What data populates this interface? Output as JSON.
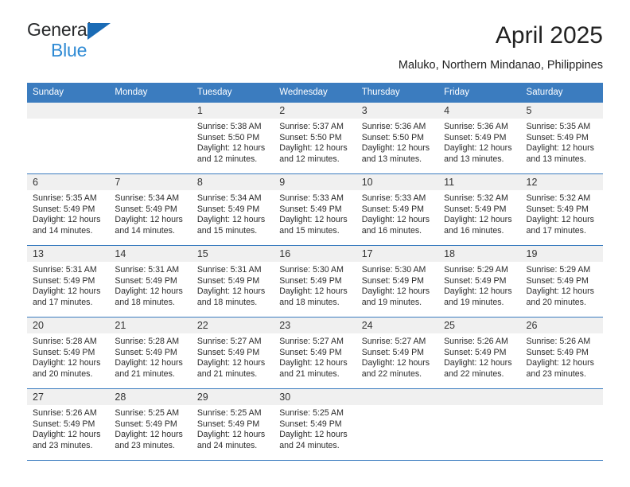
{
  "brand": {
    "name_line1": "General",
    "name_line2": "Blue",
    "color_dark": "#27292b",
    "color_blue": "#2e8ad4",
    "triangle_color": "#1a6bb5"
  },
  "header": {
    "title": "April 2025",
    "subtitle": "Maluko, Northern Mindanao, Philippines"
  },
  "theme": {
    "header_blue": "#3b7cbf",
    "daynum_gray": "#f0f0f0",
    "text": "#222222"
  },
  "calendar": {
    "weekday_headers": [
      "Sunday",
      "Monday",
      "Tuesday",
      "Wednesday",
      "Thursday",
      "Friday",
      "Saturday"
    ],
    "weeks": [
      [
        {
          "day": "",
          "sunrise": "",
          "sunset": "",
          "daylight_l1": "",
          "daylight_l2": ""
        },
        {
          "day": "",
          "sunrise": "",
          "sunset": "",
          "daylight_l1": "",
          "daylight_l2": ""
        },
        {
          "day": "1",
          "sunrise": "Sunrise: 5:38 AM",
          "sunset": "Sunset: 5:50 PM",
          "daylight_l1": "Daylight: 12 hours",
          "daylight_l2": "and 12 minutes."
        },
        {
          "day": "2",
          "sunrise": "Sunrise: 5:37 AM",
          "sunset": "Sunset: 5:50 PM",
          "daylight_l1": "Daylight: 12 hours",
          "daylight_l2": "and 12 minutes."
        },
        {
          "day": "3",
          "sunrise": "Sunrise: 5:36 AM",
          "sunset": "Sunset: 5:50 PM",
          "daylight_l1": "Daylight: 12 hours",
          "daylight_l2": "and 13 minutes."
        },
        {
          "day": "4",
          "sunrise": "Sunrise: 5:36 AM",
          "sunset": "Sunset: 5:49 PM",
          "daylight_l1": "Daylight: 12 hours",
          "daylight_l2": "and 13 minutes."
        },
        {
          "day": "5",
          "sunrise": "Sunrise: 5:35 AM",
          "sunset": "Sunset: 5:49 PM",
          "daylight_l1": "Daylight: 12 hours",
          "daylight_l2": "and 13 minutes."
        }
      ],
      [
        {
          "day": "6",
          "sunrise": "Sunrise: 5:35 AM",
          "sunset": "Sunset: 5:49 PM",
          "daylight_l1": "Daylight: 12 hours",
          "daylight_l2": "and 14 minutes."
        },
        {
          "day": "7",
          "sunrise": "Sunrise: 5:34 AM",
          "sunset": "Sunset: 5:49 PM",
          "daylight_l1": "Daylight: 12 hours",
          "daylight_l2": "and 14 minutes."
        },
        {
          "day": "8",
          "sunrise": "Sunrise: 5:34 AM",
          "sunset": "Sunset: 5:49 PM",
          "daylight_l1": "Daylight: 12 hours",
          "daylight_l2": "and 15 minutes."
        },
        {
          "day": "9",
          "sunrise": "Sunrise: 5:33 AM",
          "sunset": "Sunset: 5:49 PM",
          "daylight_l1": "Daylight: 12 hours",
          "daylight_l2": "and 15 minutes."
        },
        {
          "day": "10",
          "sunrise": "Sunrise: 5:33 AM",
          "sunset": "Sunset: 5:49 PM",
          "daylight_l1": "Daylight: 12 hours",
          "daylight_l2": "and 16 minutes."
        },
        {
          "day": "11",
          "sunrise": "Sunrise: 5:32 AM",
          "sunset": "Sunset: 5:49 PM",
          "daylight_l1": "Daylight: 12 hours",
          "daylight_l2": "and 16 minutes."
        },
        {
          "day": "12",
          "sunrise": "Sunrise: 5:32 AM",
          "sunset": "Sunset: 5:49 PM",
          "daylight_l1": "Daylight: 12 hours",
          "daylight_l2": "and 17 minutes."
        }
      ],
      [
        {
          "day": "13",
          "sunrise": "Sunrise: 5:31 AM",
          "sunset": "Sunset: 5:49 PM",
          "daylight_l1": "Daylight: 12 hours",
          "daylight_l2": "and 17 minutes."
        },
        {
          "day": "14",
          "sunrise": "Sunrise: 5:31 AM",
          "sunset": "Sunset: 5:49 PM",
          "daylight_l1": "Daylight: 12 hours",
          "daylight_l2": "and 18 minutes."
        },
        {
          "day": "15",
          "sunrise": "Sunrise: 5:31 AM",
          "sunset": "Sunset: 5:49 PM",
          "daylight_l1": "Daylight: 12 hours",
          "daylight_l2": "and 18 minutes."
        },
        {
          "day": "16",
          "sunrise": "Sunrise: 5:30 AM",
          "sunset": "Sunset: 5:49 PM",
          "daylight_l1": "Daylight: 12 hours",
          "daylight_l2": "and 18 minutes."
        },
        {
          "day": "17",
          "sunrise": "Sunrise: 5:30 AM",
          "sunset": "Sunset: 5:49 PM",
          "daylight_l1": "Daylight: 12 hours",
          "daylight_l2": "and 19 minutes."
        },
        {
          "day": "18",
          "sunrise": "Sunrise: 5:29 AM",
          "sunset": "Sunset: 5:49 PM",
          "daylight_l1": "Daylight: 12 hours",
          "daylight_l2": "and 19 minutes."
        },
        {
          "day": "19",
          "sunrise": "Sunrise: 5:29 AM",
          "sunset": "Sunset: 5:49 PM",
          "daylight_l1": "Daylight: 12 hours",
          "daylight_l2": "and 20 minutes."
        }
      ],
      [
        {
          "day": "20",
          "sunrise": "Sunrise: 5:28 AM",
          "sunset": "Sunset: 5:49 PM",
          "daylight_l1": "Daylight: 12 hours",
          "daylight_l2": "and 20 minutes."
        },
        {
          "day": "21",
          "sunrise": "Sunrise: 5:28 AM",
          "sunset": "Sunset: 5:49 PM",
          "daylight_l1": "Daylight: 12 hours",
          "daylight_l2": "and 21 minutes."
        },
        {
          "day": "22",
          "sunrise": "Sunrise: 5:27 AM",
          "sunset": "Sunset: 5:49 PM",
          "daylight_l1": "Daylight: 12 hours",
          "daylight_l2": "and 21 minutes."
        },
        {
          "day": "23",
          "sunrise": "Sunrise: 5:27 AM",
          "sunset": "Sunset: 5:49 PM",
          "daylight_l1": "Daylight: 12 hours",
          "daylight_l2": "and 21 minutes."
        },
        {
          "day": "24",
          "sunrise": "Sunrise: 5:27 AM",
          "sunset": "Sunset: 5:49 PM",
          "daylight_l1": "Daylight: 12 hours",
          "daylight_l2": "and 22 minutes."
        },
        {
          "day": "25",
          "sunrise": "Sunrise: 5:26 AM",
          "sunset": "Sunset: 5:49 PM",
          "daylight_l1": "Daylight: 12 hours",
          "daylight_l2": "and 22 minutes."
        },
        {
          "day": "26",
          "sunrise": "Sunrise: 5:26 AM",
          "sunset": "Sunset: 5:49 PM",
          "daylight_l1": "Daylight: 12 hours",
          "daylight_l2": "and 23 minutes."
        }
      ],
      [
        {
          "day": "27",
          "sunrise": "Sunrise: 5:26 AM",
          "sunset": "Sunset: 5:49 PM",
          "daylight_l1": "Daylight: 12 hours",
          "daylight_l2": "and 23 minutes."
        },
        {
          "day": "28",
          "sunrise": "Sunrise: 5:25 AM",
          "sunset": "Sunset: 5:49 PM",
          "daylight_l1": "Daylight: 12 hours",
          "daylight_l2": "and 23 minutes."
        },
        {
          "day": "29",
          "sunrise": "Sunrise: 5:25 AM",
          "sunset": "Sunset: 5:49 PM",
          "daylight_l1": "Daylight: 12 hours",
          "daylight_l2": "and 24 minutes."
        },
        {
          "day": "30",
          "sunrise": "Sunrise: 5:25 AM",
          "sunset": "Sunset: 5:49 PM",
          "daylight_l1": "Daylight: 12 hours",
          "daylight_l2": "and 24 minutes."
        },
        {
          "day": "",
          "sunrise": "",
          "sunset": "",
          "daylight_l1": "",
          "daylight_l2": ""
        },
        {
          "day": "",
          "sunrise": "",
          "sunset": "",
          "daylight_l1": "",
          "daylight_l2": ""
        },
        {
          "day": "",
          "sunrise": "",
          "sunset": "",
          "daylight_l1": "",
          "daylight_l2": ""
        }
      ]
    ]
  }
}
